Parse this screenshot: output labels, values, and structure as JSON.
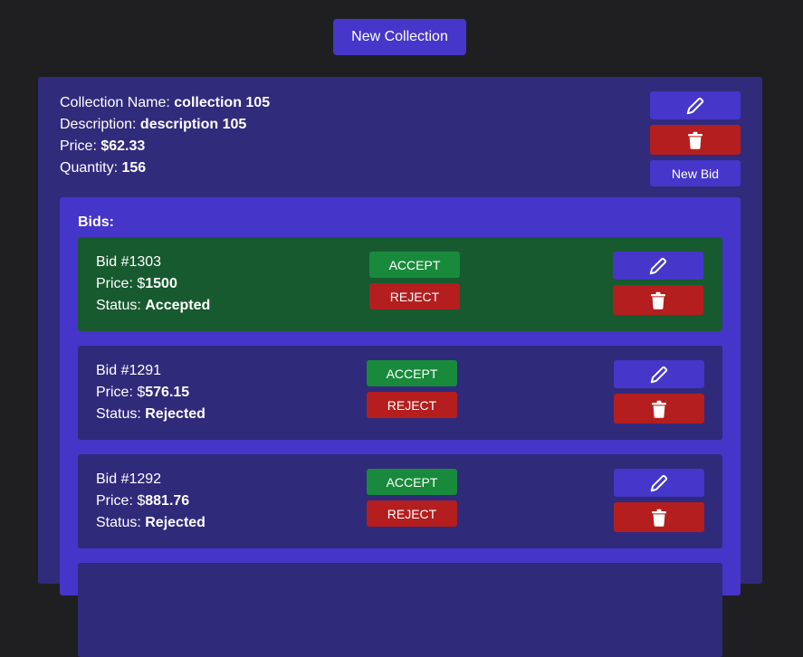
{
  "header": {
    "new_collection_label": "New Collection"
  },
  "collection": {
    "name_label": "Collection Name: ",
    "name": "collection 105",
    "description_label": "Description: ",
    "description": "description 105",
    "price_label": "Price: ",
    "price": "$62.33",
    "quantity_label": "Quantity: ",
    "quantity": "156",
    "new_bid_label": "New Bid",
    "edit_icon": "pencil-icon",
    "delete_icon": "trash-icon"
  },
  "bids": {
    "title": "Bids:",
    "items": [
      {
        "id_text": "Bid #1303",
        "price_label": "Price: $",
        "price": "1500",
        "status_label": "Status: ",
        "status": "Accepted",
        "accept_label": "ACCEPT",
        "reject_label": "REJECT"
      },
      {
        "id_text": "Bid #1291",
        "price_label": "Price: $",
        "price": "576.15",
        "status_label": "Status: ",
        "status": "Rejected",
        "accept_label": "ACCEPT",
        "reject_label": "REJECT"
      },
      {
        "id_text": "Bid #1292",
        "price_label": "Price: $",
        "price": "881.76",
        "status_label": "Status: ",
        "status": "Rejected",
        "accept_label": "ACCEPT",
        "reject_label": "REJECT"
      }
    ]
  },
  "colors": {
    "page_bg": "#1f1f22",
    "card_bg": "#312b7c",
    "panel_bg": "#4535c8",
    "primary": "#4636c9",
    "danger": "#b41e1e",
    "success": "#198a3c",
    "accepted_bg": "#175a2f"
  }
}
